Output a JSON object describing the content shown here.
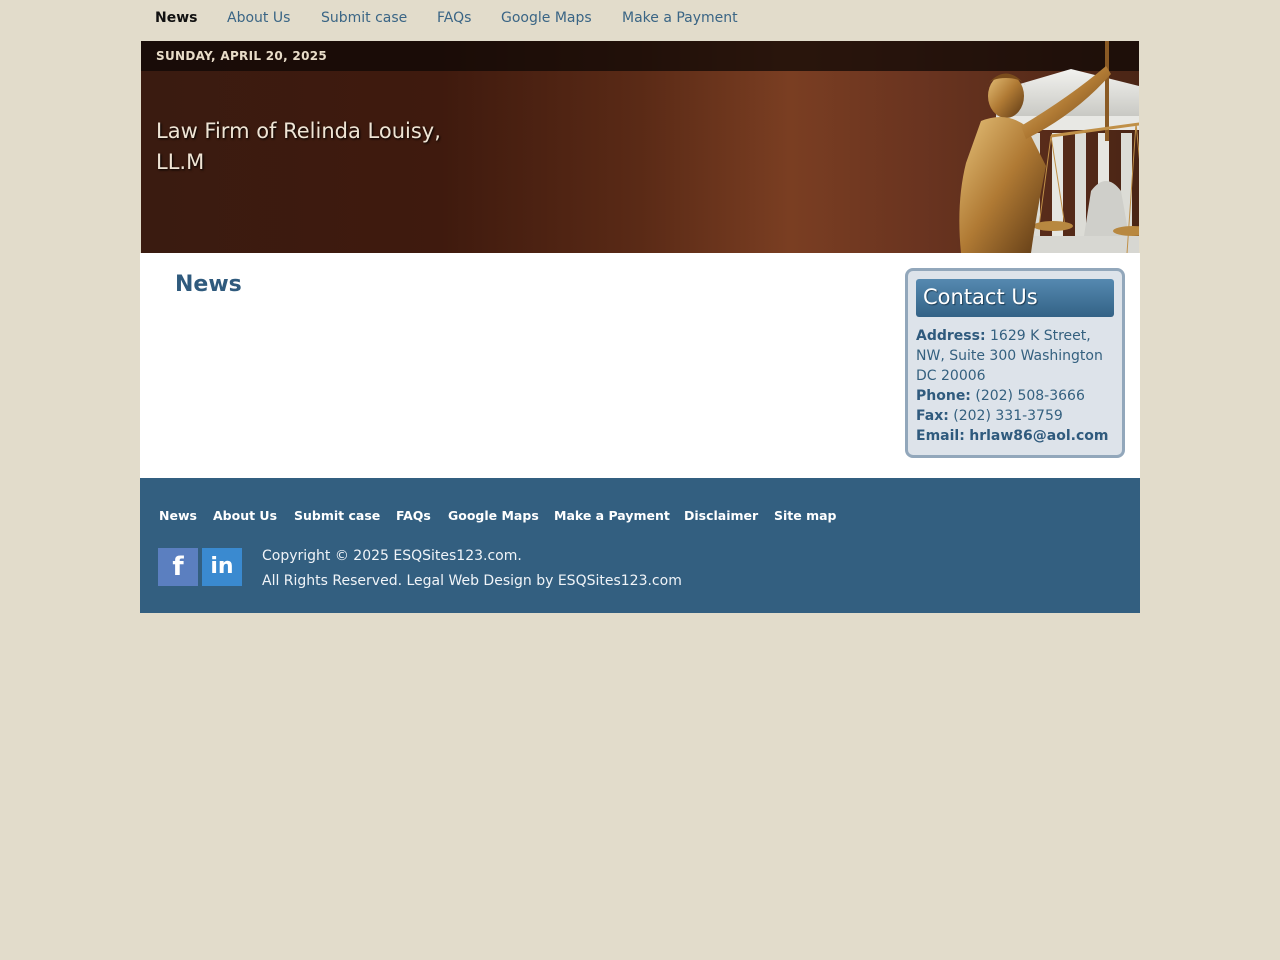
{
  "top_nav": {
    "items": [
      "News",
      "About Us",
      "Submit case",
      "FAQs",
      "Google Maps",
      "Make a Payment"
    ],
    "active": "News"
  },
  "header": {
    "date": "SUNDAY, APRIL 20, 2025",
    "firm_name": "Law Firm of Relinda Louisy, LL.M"
  },
  "main": {
    "heading": "News"
  },
  "contact": {
    "title": "Contact Us",
    "address_label": "Address:",
    "address": "1629 K Street, NW, Suite 300 Washington DC 20006",
    "phone_label": "Phone:",
    "phone": "(202) 508-3666",
    "fax_label": "Fax:",
    "fax": "(202) 331-3759",
    "email_label": "Email:",
    "email": "hrlaw86@aol.com"
  },
  "footer": {
    "nav": [
      "News",
      "About Us",
      "Submit case",
      "FAQs",
      "Google Maps",
      "Make a Payment",
      "Disclaimer",
      "Site map"
    ],
    "copyright_line1": "Copyright © 2025 ESQSites123.com.",
    "copyright_line2": "All Rights Reserved. Legal Web Design by ESQSites123.com",
    "social": [
      {
        "icon": "facebook-icon",
        "glyph": "f",
        "color": "#5b7fc0"
      },
      {
        "icon": "linkedin-icon",
        "glyph": "in",
        "color": "#3a8ad0"
      }
    ]
  },
  "colors": {
    "background": "#e2dccb",
    "link": "#3a6585",
    "heading": "#2f5a7d",
    "footer": "#335f80",
    "banner": "#3f1a0e"
  }
}
